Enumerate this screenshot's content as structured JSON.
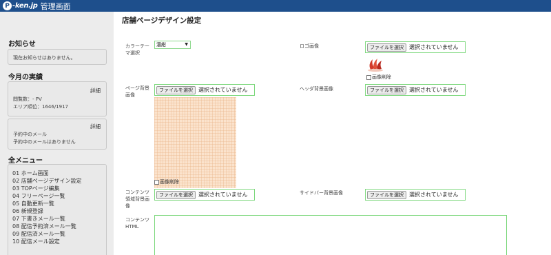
{
  "header": {
    "logo_mark": "P",
    "logo_text": "-ken.jp",
    "title": "管理画面"
  },
  "sidebar": {
    "notice": {
      "heading": "お知らせ",
      "text": "現在お知らせはありません。"
    },
    "results": {
      "heading": "今月の実績",
      "stats_box": {
        "detail_label": "詳細",
        "views": "閲覧数：- PV",
        "area_rank": "エリア順位：1646/1917"
      },
      "reserve_box": {
        "detail_label": "詳細",
        "line1": "予約中のメール",
        "line2": "予約中のメールはありません"
      }
    },
    "menu": {
      "heading": "全メニュー",
      "items": [
        "01 ホーム画面",
        "02 店舗ページデザイン設定",
        "03 TOPページ編集",
        "04 フリーページ一覧",
        "05 自動更新一覧",
        "06 新規登録",
        "07 下書きメール一覧",
        "08 配信予約済メール一覧",
        "09 配信済メール一覧",
        "10 配信メール設定"
      ]
    }
  },
  "main": {
    "page_title": "店舗ページデザイン設定",
    "color_theme": {
      "label_line1": "カラーテー",
      "label_line2": "マ選択",
      "selected": "濃紺"
    },
    "page_bg": {
      "label_line1": "ページ背景",
      "label_line2": "画像",
      "delete_label": "画像削除"
    },
    "contents_bg": {
      "label_line1": "コンテンツ",
      "label_line2": "領域背景画",
      "label_line3": "像"
    },
    "contents_html": {
      "label_line1": "コンテンツ",
      "label_line2": "HTML"
    },
    "logo": {
      "label": "ロゴ画像",
      "delete_label": "画像削除"
    },
    "header_bg": {
      "label": "ヘッダ背景画像"
    },
    "sidebar_bg": {
      "label": "サイドバー背景画像"
    },
    "file_button_label": "ファイルを選択",
    "file_status": "選択されていません"
  },
  "colors": {
    "header_bg": "#1e4f8c",
    "sidebar_bg": "#ececec",
    "field_border": "#7dd87d",
    "bg_preview": "#fbe3cd",
    "logo_red": "#d23a2a"
  }
}
